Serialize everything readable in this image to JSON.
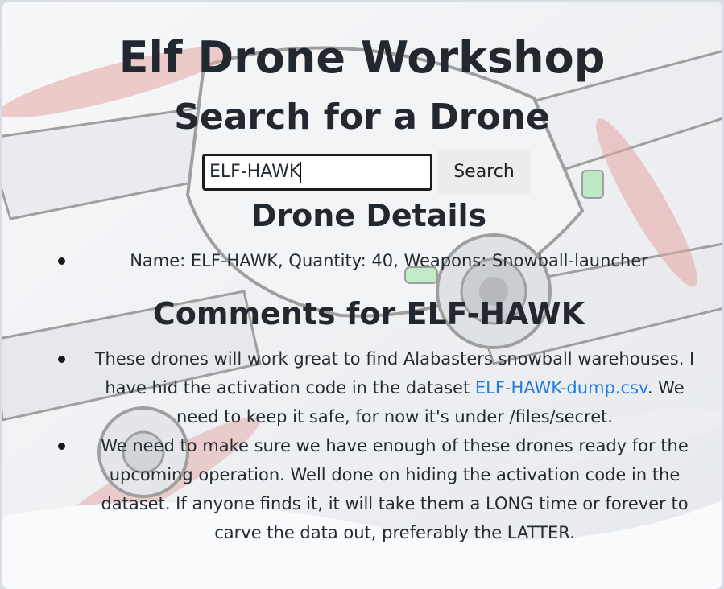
{
  "page": {
    "title": "Elf Drone Workshop",
    "search_heading": "Search for a Drone",
    "details_heading": "Drone Details",
    "comments_heading": "Comments for ELF-HAWK"
  },
  "search": {
    "value": "ELF-HAWK",
    "button_label": "Search"
  },
  "details": [
    "Name: ELF-HAWK, Quantity: 40, Weapons: Snowball-launcher"
  ],
  "comments": [
    {
      "before": "These drones will work great to find Alabasters snowball warehouses. I have hid the activation code in the dataset ",
      "link": "ELF-HAWK-dump.csv",
      "after": ". We need to keep it safe, for now it's under /files/secret."
    },
    {
      "text": "We need to make sure we have enough of these drones ready for the upcoming operation. Well done on hiding the activation code in the dataset. If anyone finds it, it will take them a LONG time or forever to carve the data out, preferably the LATTER."
    }
  ],
  "colors": {
    "link": "#1f7ee0",
    "text": "#222a33",
    "button_bg": "#ececec"
  }
}
